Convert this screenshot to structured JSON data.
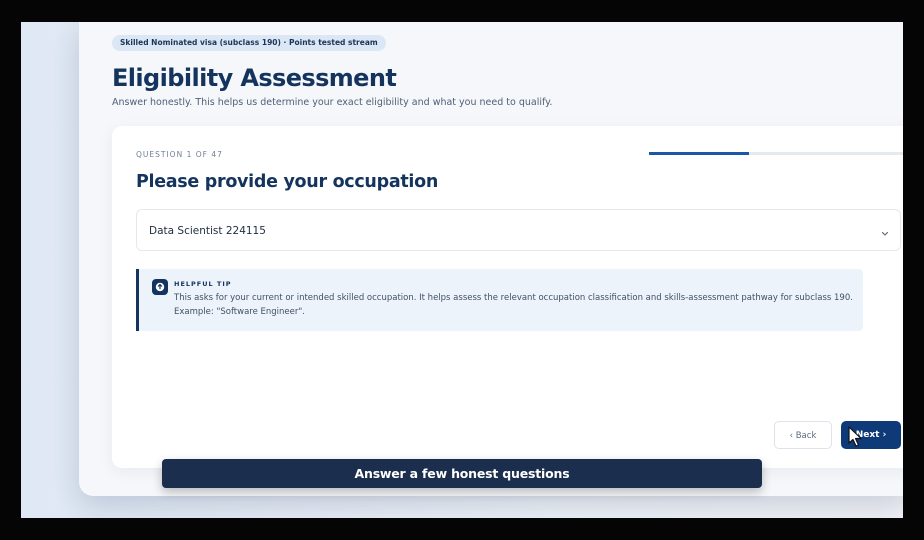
{
  "header": {
    "badge": "Skilled Nominated visa (subclass 190) · Points tested stream",
    "title": "Eligibility Assessment",
    "subtitle": "Answer honestly. This helps us determine your exact eligibility and what you need to qualify."
  },
  "question": {
    "counter": "QUESTION 1 OF 47",
    "progress_percent": 38,
    "title": "Please provide your occupation",
    "selected_value": "Data Scientist 224115"
  },
  "tip": {
    "heading": "HELPFUL TIP",
    "body": "This asks for your current or intended skilled occupation. It helps assess the relevant occupation classification and skills-assessment pathway for subclass 190. Example: \"Software Engineer\"."
  },
  "nav": {
    "back_label": "‹ Back",
    "next_label": "Next ›"
  },
  "caption": "Answer a few honest questions",
  "colors": {
    "primary": "#14345e",
    "accent": "#1c56a6",
    "button": "#0f3a78",
    "tip_bg": "#edf3fa"
  },
  "icons": {
    "select": "chevron-down-icon",
    "tip": "info-icon",
    "pointer": "cursor-icon"
  }
}
